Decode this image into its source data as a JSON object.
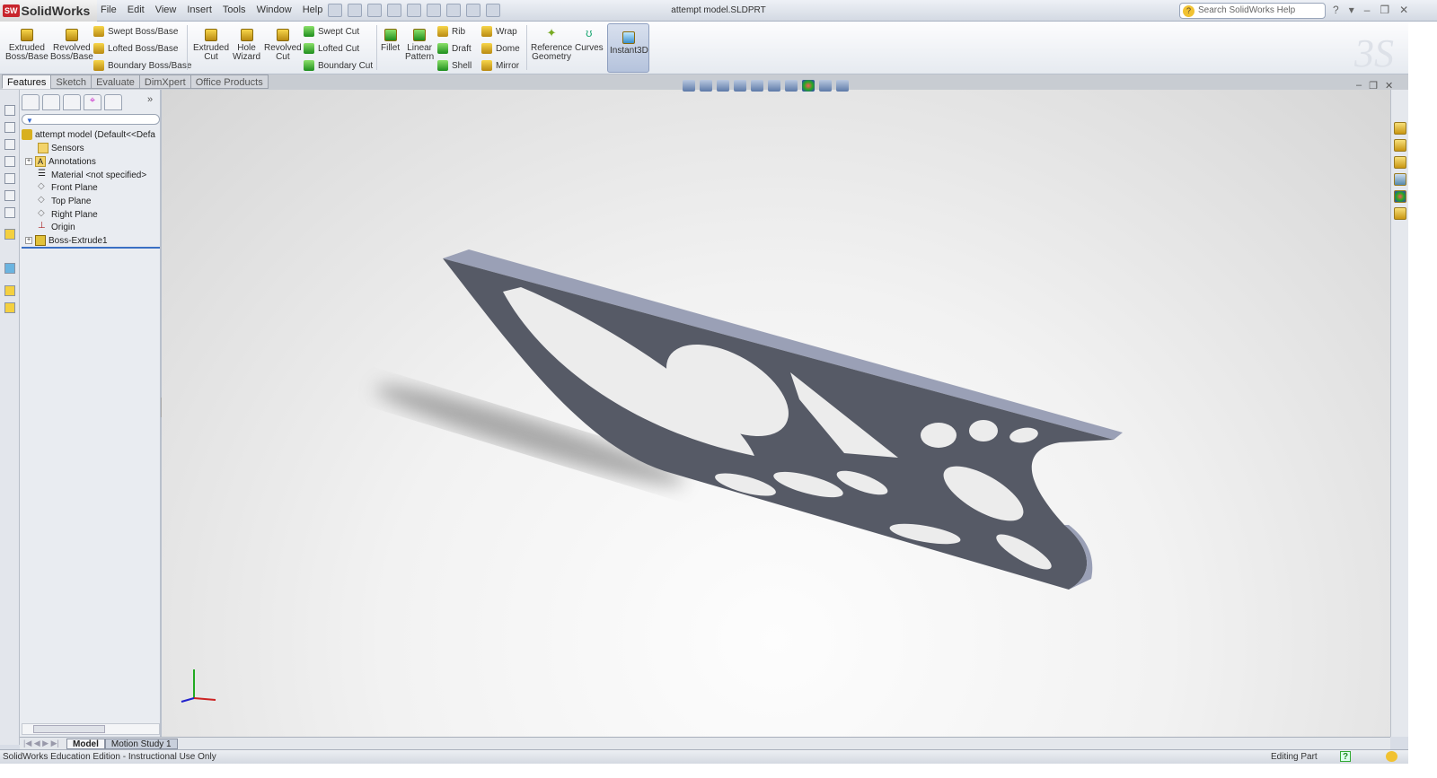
{
  "app": {
    "name": "SolidWorks",
    "logo_badge": "SW",
    "document_title": "attempt model.SLDPRT"
  },
  "menu": [
    "File",
    "Edit",
    "View",
    "Insert",
    "Tools",
    "Window",
    "Help"
  ],
  "search": {
    "placeholder": "Search SolidWorks Help"
  },
  "window_controls": [
    "?",
    "▾",
    "–",
    "❐",
    "✕"
  ],
  "commands": {
    "extruded_boss": "Extruded\nBoss/Base",
    "revolved_boss": "Revolved\nBoss/Base",
    "swept_boss": "Swept Boss/Base",
    "lofted_boss": "Lofted Boss/Base",
    "boundary_boss": "Boundary Boss/Base",
    "extruded_cut": "Extruded\nCut",
    "hole_wizard": "Hole\nWizard",
    "revolved_cut": "Revolved\nCut",
    "swept_cut": "Swept Cut",
    "lofted_cut": "Lofted Cut",
    "boundary_cut": "Boundary Cut",
    "fillet": "Fillet",
    "linear_pattern": "Linear\nPattern",
    "rib": "Rib",
    "draft": "Draft",
    "shell": "Shell",
    "wrap": "Wrap",
    "dome": "Dome",
    "mirror": "Mirror",
    "reference_geometry": "Reference\nGeometry",
    "curves": "Curves",
    "instant3d": "Instant3D"
  },
  "tabs": [
    "Features",
    "Sketch",
    "Evaluate",
    "DimXpert",
    "Office Products"
  ],
  "tree": {
    "root": "attempt model  (Default<<Defa",
    "items": [
      "Sensors",
      "Annotations",
      "Material <not specified>",
      "Front Plane",
      "Top Plane",
      "Right Plane",
      "Origin",
      "Boss-Extrude1"
    ]
  },
  "bottom_tabs": [
    "Model",
    "Motion Study 1"
  ],
  "status": {
    "left": "SolidWorks Education Edition - Instructional Use Only",
    "mode": "Editing Part",
    "help": "?"
  },
  "colors": {
    "part": "#575a66",
    "part_edge": "#9ea3b8",
    "hole": "#f0f0f0"
  }
}
